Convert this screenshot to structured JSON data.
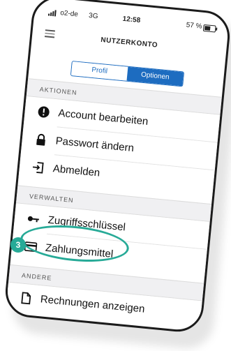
{
  "status_bar": {
    "carrier": "o2-de",
    "network": "3G",
    "time": "12:58",
    "battery_percent": "57 %",
    "battery_level": 0.57
  },
  "header": {
    "title": "NUTZERKONTO",
    "menu_icon": "hamburger-menu-icon"
  },
  "tabs": [
    {
      "label": "Profil",
      "selected": false
    },
    {
      "label": "Optionen",
      "selected": true
    }
  ],
  "sections": {
    "actions": {
      "label": "AKTIONEN",
      "items": [
        {
          "label": "Account bearbeiten",
          "icon": "account-alert-icon"
        },
        {
          "label": "Passwort ändern",
          "icon": "lock-icon"
        },
        {
          "label": "Abmelden",
          "icon": "logout-icon"
        }
      ]
    },
    "manage": {
      "label": "VERWALTEN",
      "items": [
        {
          "label": "Zugriffsschlüssel",
          "icon": "key-icon"
        },
        {
          "label": "Zahlungsmittel",
          "icon": "credit-card-icon"
        }
      ]
    },
    "other": {
      "label": "ANDERE",
      "items": [
        {
          "label": "Rechnungen anzeigen",
          "icon": "document-icon"
        }
      ]
    }
  },
  "callout": {
    "number": "3",
    "color": "#27aa97"
  },
  "colors": {
    "accent": "#1d6cc0",
    "callout": "#27aa97",
    "section_bg": "#f0f0f2"
  }
}
